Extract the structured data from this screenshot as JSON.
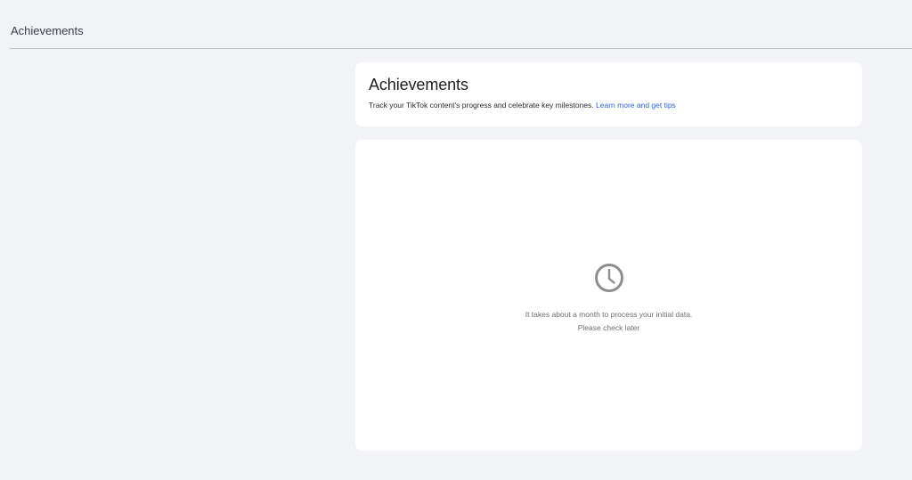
{
  "header": {
    "title": "Achievements"
  },
  "intro": {
    "title": "Achievements",
    "description": "Track your TikTok content's progress and celebrate key milestones.",
    "link_label": "Learn more and get tips"
  },
  "empty_state": {
    "icon": "clock-icon",
    "line1": "It takes about a month to process your initial data.",
    "line2": "Please check later"
  },
  "colors": {
    "background": "#f1f3f7",
    "card": "#ffffff",
    "link": "#2f62d9",
    "icon": "#8e8e8e"
  }
}
